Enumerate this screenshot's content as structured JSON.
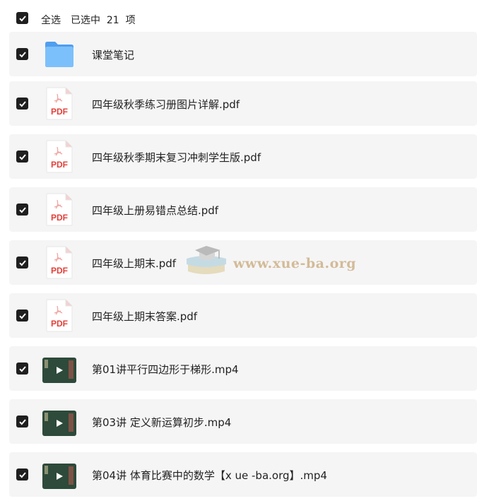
{
  "header": {
    "select_all_label": "全选",
    "selected_summary": "已选中  21  项"
  },
  "files": [
    {
      "name": "课堂笔记",
      "type": "folder-icon"
    },
    {
      "name": "四年级秋季练习册图片详解.pdf",
      "type": "pdf-icon"
    },
    {
      "name": "四年级秋季期末复习冲刺学生版.pdf",
      "type": "pdf-icon"
    },
    {
      "name": "四年级上册易错点总结.pdf",
      "type": "pdf-icon"
    },
    {
      "name": "四年级上期末.pdf",
      "type": "pdf-icon"
    },
    {
      "name": "四年级上期末答案.pdf",
      "type": "pdf-icon"
    },
    {
      "name": "第01讲平行四边形于梯形.mp4",
      "type": "video-thumbnail-icon"
    },
    {
      "name": "第03讲 定义新运算初步.mp4",
      "type": "video-thumbnail-icon"
    },
    {
      "name": "第04讲 体育比赛中的数学【x ue -ba.org】.mp4",
      "type": "video-thumbnail-icon"
    }
  ],
  "pdf_badge": "PDF",
  "watermark": "www.xue-ba.org",
  "colors": {
    "row_bg": "#f5f5f6",
    "checkbox": "#1f1f1f",
    "pdf_red": "#e0403a",
    "folder_blue": "#5aa9f4"
  }
}
